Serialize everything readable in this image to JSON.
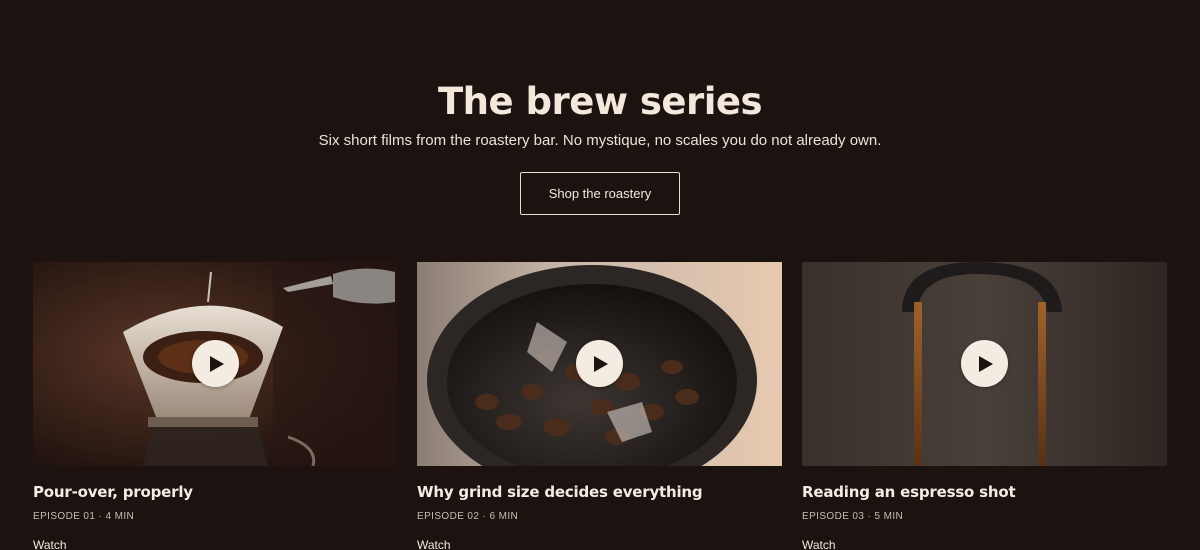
{
  "hero": {
    "title": "The brew series",
    "subtitle": "Six short films from the roastery bar. No mystique, no scales you do not already own.",
    "cta_label": "Shop the roastery"
  },
  "episodes": [
    {
      "title": "Pour-over, properly",
      "meta": "EPISODE 01 · 4 MIN",
      "watch_label": "Watch",
      "thumbnail_icon": "play-icon"
    },
    {
      "title": "Why grind size decides everything",
      "meta": "EPISODE 02 · 6 MIN",
      "watch_label": "Watch",
      "thumbnail_icon": "play-icon"
    },
    {
      "title": "Reading an espresso shot",
      "meta": "EPISODE 03 · 5 MIN",
      "watch_label": "Watch",
      "thumbnail_icon": "play-icon"
    }
  ],
  "colors": {
    "background": "#1c1210",
    "text": "#f2e8dc",
    "play_button": "#f4ece2"
  }
}
